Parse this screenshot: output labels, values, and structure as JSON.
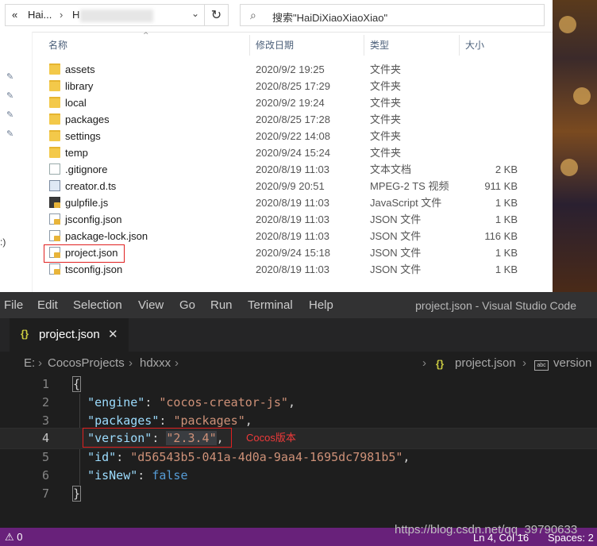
{
  "explorer": {
    "address": {
      "back_glyph": "«",
      "crumb1": "Hai...",
      "crumb_sep": "›",
      "crumb2": "H",
      "dropdown_glyph": "⌄"
    },
    "refresh_glyph": "↻",
    "search_placeholder": "搜索\"HaiDiXiaoXiaoXiao\"",
    "nav_edge_text": ":)",
    "columns": {
      "name": "名称",
      "date": "修改日期",
      "type": "类型",
      "size": "大小"
    },
    "sort_caret": "^",
    "rows": [
      {
        "name": "assets",
        "date": "2020/9/2 19:25",
        "type": "文件夹",
        "size": "",
        "icon": "folder-icon"
      },
      {
        "name": "library",
        "date": "2020/8/25 17:29",
        "type": "文件夹",
        "size": "",
        "icon": "folder-icon"
      },
      {
        "name": "local",
        "date": "2020/9/2 19:24",
        "type": "文件夹",
        "size": "",
        "icon": "folder-icon"
      },
      {
        "name": "packages",
        "date": "2020/8/25 17:28",
        "type": "文件夹",
        "size": "",
        "icon": "folder-icon"
      },
      {
        "name": "settings",
        "date": "2020/9/22 14:08",
        "type": "文件夹",
        "size": "",
        "icon": "folder-icon"
      },
      {
        "name": "temp",
        "date": "2020/9/24 15:24",
        "type": "文件夹",
        "size": "",
        "icon": "folder-icon"
      },
      {
        "name": ".gitignore",
        "date": "2020/8/19 11:03",
        "type": "文本文档",
        "size": "2 KB",
        "icon": "text-file-icon"
      },
      {
        "name": "creator.d.ts",
        "date": "2020/9/9 20:51",
        "type": "MPEG-2 TS 视频",
        "size": "911 KB",
        "icon": "video-file-icon"
      },
      {
        "name": "gulpfile.js",
        "date": "2020/8/19 11:03",
        "type": "JavaScript 文件",
        "size": "1 KB",
        "icon": "js-file-icon"
      },
      {
        "name": "jsconfig.json",
        "date": "2020/8/19 11:03",
        "type": "JSON 文件",
        "size": "1 KB",
        "icon": "json-file-icon"
      },
      {
        "name": "package-lock.json",
        "date": "2020/8/19 11:03",
        "type": "JSON 文件",
        "size": "116 KB",
        "icon": "json-file-icon"
      },
      {
        "name": "project.json",
        "date": "2020/9/24 15:18",
        "type": "JSON 文件",
        "size": "1 KB",
        "icon": "json-file-icon"
      },
      {
        "name": "tsconfig.json",
        "date": "2020/8/19 11:03",
        "type": "JSON 文件",
        "size": "1 KB",
        "icon": "json-file-icon"
      }
    ]
  },
  "vscode": {
    "menu": [
      "File",
      "Edit",
      "Selection",
      "View",
      "Go",
      "Run",
      "Terminal",
      "Help"
    ],
    "window_title": "project.json - Visual Studio Code",
    "tab": {
      "icon_text": "{}",
      "label": "project.json",
      "close": "✕"
    },
    "breadcrumb": {
      "drive": "E:",
      "folder1": "CocosProjects",
      "folder2": "hdxxx",
      "sep": "›",
      "file_icon_text": "{}",
      "file": "project.json",
      "symbol_icon_text": "abc",
      "symbol": "version"
    },
    "line_numbers": [
      "1",
      "2",
      "3",
      "4",
      "5",
      "6",
      "7"
    ],
    "code": {
      "l1_open": "{",
      "l2_key": "\"engine\"",
      "l2_val": "\"cocos-creator-js\"",
      "l3_key": "\"packages\"",
      "l3_val": "\"packages\"",
      "l4_key": "\"version\"",
      "l4_val": "\"2.3.4\"",
      "l5_key": "\"id\"",
      "l5_val": "\"d56543b5-041a-4d0a-9aa4-1695dc7981b5\"",
      "l6_key": "\"isNew\"",
      "l6_val": "false",
      "l7_close": "}",
      "colon": ": ",
      "comma": ","
    },
    "annotation": "Cocos版本",
    "status": {
      "warnings": "⚠ 0",
      "watermark": "https://blog.csdn.net/qq_39790633",
      "position": "Ln 4, Col 16",
      "spaces": "Spaces: 2"
    }
  }
}
